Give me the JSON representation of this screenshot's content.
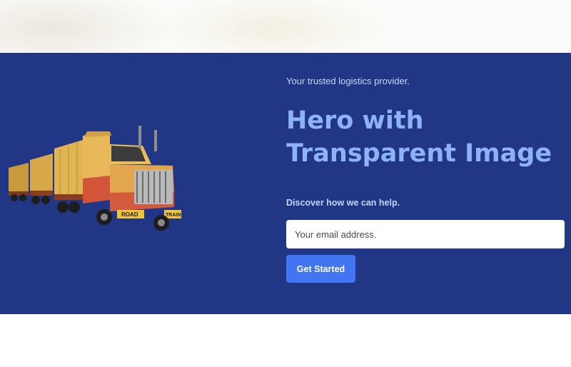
{
  "hero": {
    "tagline": "Your trusted logistics provider.",
    "title_line1": "Hero with",
    "title_line2": "Transparent Image",
    "subline": "Discover how we can help.",
    "email_placeholder": "Your email address.",
    "cta_label": "Get Started",
    "truck_plate": "ROAD",
    "truck_plate2": "TRAIN"
  },
  "colors": {
    "hero_bg": "#213684",
    "title": "#8db3f6",
    "text": "#c6d6ff",
    "button": "#4175f2"
  },
  "icons": {
    "truck": "road-train-truck-image"
  }
}
